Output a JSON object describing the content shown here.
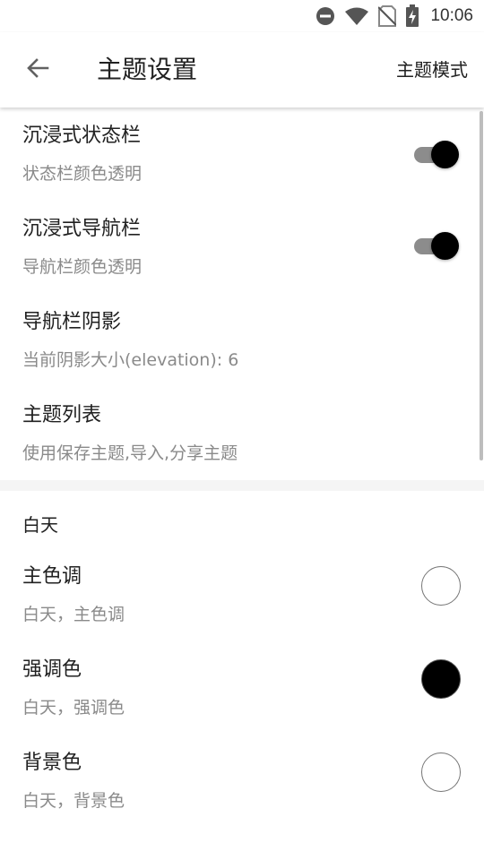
{
  "status_bar": {
    "time": "10:06",
    "icons": [
      "do-not-disturb-icon",
      "wifi-icon",
      "no-sim-icon",
      "battery-charging-icon"
    ]
  },
  "app_bar": {
    "title": "主题设置",
    "back_icon": "arrow-back-icon",
    "action_label": "主题模式"
  },
  "preferences": [
    {
      "id": "immersive-status-bar",
      "title": "沉浸式状态栏",
      "summary": "状态栏颜色透明",
      "control": "switch",
      "checked": true
    },
    {
      "id": "immersive-nav-bar",
      "title": "沉浸式导航栏",
      "summary": "导航栏颜色透明",
      "control": "switch",
      "checked": true
    },
    {
      "id": "nav-bar-shadow",
      "title": "导航栏阴影",
      "summary": "当前阴影大小(elevation): 6",
      "control": "none"
    },
    {
      "id": "theme-list",
      "title": "主题列表",
      "summary": "使用保存主题,导入,分享主题",
      "control": "none"
    }
  ],
  "day_section": {
    "category": "白天",
    "items": [
      {
        "id": "primary-color",
        "title": "主色调",
        "summary": "白天，主色调",
        "color": "#ffffff"
      },
      {
        "id": "accent-color",
        "title": "强调色",
        "summary": "白天，强调色",
        "color": "#000000"
      },
      {
        "id": "background-color",
        "title": "背景色",
        "summary": "白天，背景色",
        "color": "#ffffff"
      }
    ]
  },
  "colors": {
    "switch_thumb": "#000000",
    "switch_track": "#8c8c8c",
    "summary_text": "#8a8a8a",
    "title_text": "#212121"
  }
}
